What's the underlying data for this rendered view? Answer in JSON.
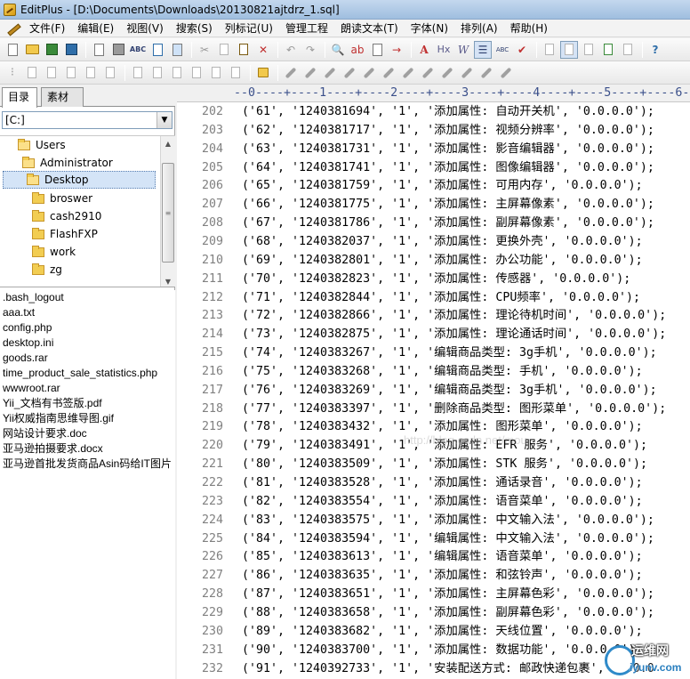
{
  "window": {
    "title": "EditPlus - [D:\\Documents\\Downloads\\20130821ajtdrz_1.sql]"
  },
  "menu": [
    {
      "label": "文件(F)",
      "name": "menu-file"
    },
    {
      "label": "编辑(E)",
      "name": "menu-edit"
    },
    {
      "label": "视图(V)",
      "name": "menu-view"
    },
    {
      "label": "搜索(S)",
      "name": "menu-search"
    },
    {
      "label": "列标记(U)",
      "name": "menu-column"
    },
    {
      "label": "管理工程",
      "name": "menu-project"
    },
    {
      "label": "朗读文本(T)",
      "name": "menu-speech"
    },
    {
      "label": "字体(N)",
      "name": "menu-font"
    },
    {
      "label": "排列(A)",
      "name": "menu-arrange"
    },
    {
      "label": "帮助(H)",
      "name": "menu-help"
    }
  ],
  "toolbar_glyphs": {
    "spell": "ABC",
    "find": "🔍",
    "a_font": "A",
    "hx": "Hx",
    "w": "W",
    "check": "✔",
    "help": "?"
  },
  "left_panel": {
    "tabs": [
      "目录",
      "素材"
    ],
    "drive": "[C:]",
    "tree": [
      "Users",
      "Administrator",
      "Desktop",
      "broswer",
      "cash2910",
      "FlashFXP",
      "work",
      "zg"
    ],
    "files": [
      ".bash_logout",
      "aaa.txt",
      "config.php",
      "desktop.ini",
      "goods.rar",
      "time_product_sale_statistics.php",
      "wwwroot.rar",
      "Yii_文档有书签版.pdf",
      "Yii权威指南思维导图.gif",
      "网站设计要求.doc",
      "亚马逊拍摄要求.docx",
      "亚马逊首批发货商品Asin码给IT图片"
    ]
  },
  "ruler": "--0----+----1----+----2----+----3----+----4----+----5----+----6-",
  "editor": {
    "lines": [
      {
        "n": "202",
        "text": "('61', '1240381694', '1', '添加属性: 自动开关机', '0.0.0.0');"
      },
      {
        "n": "203",
        "text": "('62', '1240381717', '1', '添加属性: 视频分辨率', '0.0.0.0');"
      },
      {
        "n": "204",
        "text": "('63', '1240381731', '1', '添加属性: 影音编辑器', '0.0.0.0');"
      },
      {
        "n": "205",
        "text": "('64', '1240381741', '1', '添加属性: 图像编辑器', '0.0.0.0');"
      },
      {
        "n": "206",
        "text": "('65', '1240381759', '1', '添加属性: 可用内存', '0.0.0.0');"
      },
      {
        "n": "207",
        "text": "('66', '1240381775', '1', '添加属性: 主屏幕像素', '0.0.0.0');"
      },
      {
        "n": "208",
        "text": "('67', '1240381786', '1', '添加属性: 副屏幕像素', '0.0.0.0');"
      },
      {
        "n": "209",
        "text": "('68', '1240382037', '1', '添加属性: 更换外壳', '0.0.0.0');"
      },
      {
        "n": "210",
        "text": "('69', '1240382801', '1', '添加属性: 办公功能', '0.0.0.0');"
      },
      {
        "n": "211",
        "text": "('70', '1240382823', '1', '添加属性: 传感器', '0.0.0.0');"
      },
      {
        "n": "212",
        "text": "('71', '1240382844', '1', '添加属性: CPU频率', '0.0.0.0');"
      },
      {
        "n": "213",
        "text": "('72', '1240382866', '1', '添加属性: 理论待机时间', '0.0.0.0');"
      },
      {
        "n": "214",
        "text": "('73', '1240382875', '1', '添加属性: 理论通话时间', '0.0.0.0');"
      },
      {
        "n": "215",
        "text": "('74', '1240383267', '1', '编辑商品类型: 3g手机', '0.0.0.0');"
      },
      {
        "n": "216",
        "text": "('75', '1240383268', '1', '编辑商品类型: 手机', '0.0.0.0');"
      },
      {
        "n": "217",
        "text": "('76', '1240383269', '1', '编辑商品类型: 3g手机', '0.0.0.0');"
      },
      {
        "n": "218",
        "text": "('77', '1240383397', '1', '删除商品类型: 图形菜单', '0.0.0.0');"
      },
      {
        "n": "219",
        "text": "('78', '1240383432', '1', '添加属性: 图形菜单', '0.0.0.0');"
      },
      {
        "n": "220",
        "text": "('79', '1240383491', '1', '添加属性: EFR 服务', '0.0.0.0');"
      },
      {
        "n": "221",
        "text": "('80', '1240383509', '1', '添加属性: STK 服务', '0.0.0.0');"
      },
      {
        "n": "222",
        "text": "('81', '1240383528', '1', '添加属性: 通话录音', '0.0.0.0');"
      },
      {
        "n": "223",
        "text": "('82', '1240383554', '1', '添加属性: 语音菜单', '0.0.0.0');"
      },
      {
        "n": "224",
        "text": "('83', '1240383575', '1', '添加属性: 中文输入法', '0.0.0.0');"
      },
      {
        "n": "225",
        "text": "('84', '1240383594', '1', '编辑属性: 中文输入法', '0.0.0.0');"
      },
      {
        "n": "226",
        "text": "('85', '1240383613', '1', '编辑属性: 语音菜单', '0.0.0.0');"
      },
      {
        "n": "227",
        "text": "('86', '1240383635', '1', '添加属性: 和弦铃声', '0.0.0.0');"
      },
      {
        "n": "228",
        "text": "('87', '1240383651', '1', '添加属性: 主屏幕色彩', '0.0.0.0');"
      },
      {
        "n": "229",
        "text": "('88', '1240383658', '1', '添加属性: 副屏幕色彩', '0.0.0.0');"
      },
      {
        "n": "230",
        "text": "('89', '1240383682', '1', '添加属性: 天线位置', '0.0.0.0');"
      },
      {
        "n": "231",
        "text": "('90', '1240383700', '1', '添加属性: 数据功能', '0.0.0.0');"
      },
      {
        "n": "232",
        "text": "('91', '1240392733', '1', '安装配送方式: 邮政快递包裹', '0.0.0"
      }
    ]
  },
  "watermark": "http://blog.csdn.net/mou",
  "logo": {
    "name": "运维网",
    "url": "iyunv.com"
  },
  "colors": {
    "selection": "#d4e4f7",
    "line_number": "#808080",
    "ruler": "#3a4f8a"
  }
}
